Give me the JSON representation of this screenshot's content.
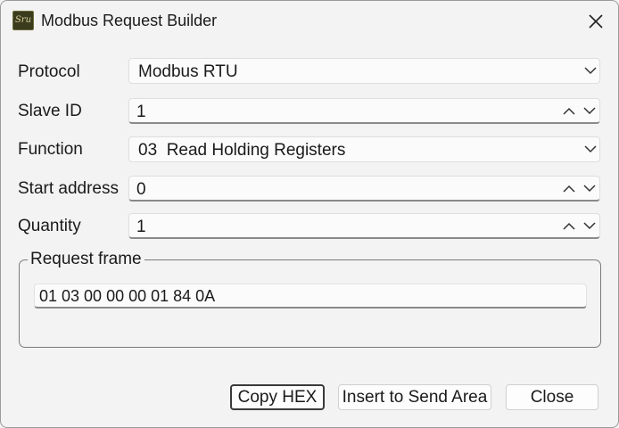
{
  "window": {
    "title": "Modbus Request Builder",
    "app_icon_text": "Sru",
    "close_glyph": "✕"
  },
  "form": {
    "protocol": {
      "label": "Protocol",
      "value": "Modbus RTU"
    },
    "slave_id": {
      "label": "Slave ID",
      "value": "1"
    },
    "function": {
      "label": "Function",
      "value": "03  Read Holding Registers"
    },
    "start_address": {
      "label": "Start address",
      "value": "0"
    },
    "quantity": {
      "label": "Quantity",
      "value": "1"
    }
  },
  "request_frame": {
    "title": "Request frame",
    "value": "01 03 00 00 00 01 84 0A"
  },
  "buttons": {
    "copy_hex": "Copy HEX",
    "insert": "Insert to Send Area",
    "close": "Close"
  },
  "icons": {
    "dropdown": "chevron-down-icon",
    "spin_up": "chevron-up-icon",
    "spin_down": "chevron-down-icon",
    "close": "close-icon"
  }
}
